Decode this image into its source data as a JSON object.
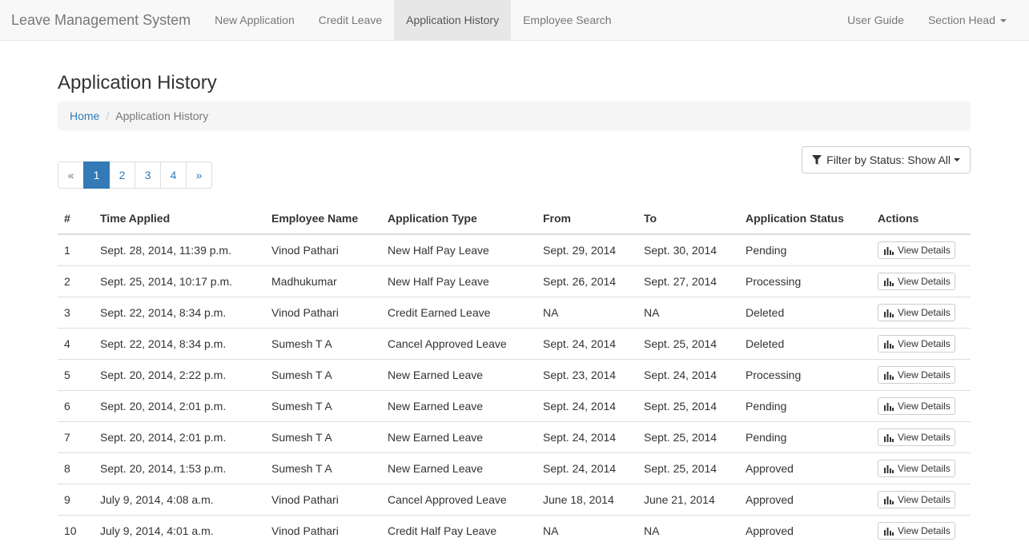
{
  "navbar": {
    "brand": "Leave Management System",
    "left_items": [
      {
        "label": "New Application",
        "active": false
      },
      {
        "label": "Credit Leave",
        "active": false
      },
      {
        "label": "Application History",
        "active": true
      },
      {
        "label": "Employee Search",
        "active": false
      }
    ],
    "user_guide": "User Guide",
    "user_menu": "Section Head"
  },
  "page": {
    "title": "Application History",
    "breadcrumb": {
      "home": "Home",
      "current": "Application History",
      "separator": "/"
    }
  },
  "pagination": {
    "prev": "«",
    "next": "»",
    "pages": [
      "1",
      "2",
      "3",
      "4"
    ],
    "current_page": "1"
  },
  "filter": {
    "icon": "filter-icon",
    "label": "Filter by Status: Show All"
  },
  "table": {
    "headers": [
      "#",
      "Time Applied",
      "Employee Name",
      "Application Type",
      "From",
      "To",
      "Application Status",
      "Actions"
    ],
    "action_label": "View Details",
    "action_icon": "bar-chart-icon",
    "rows": [
      {
        "num": "1",
        "time": "Sept. 28, 2014, 11:39 p.m.",
        "name": "Vinod Pathari",
        "type": "New Half Pay Leave",
        "from": "Sept. 29, 2014",
        "to": "Sept. 30, 2014",
        "status": "Pending"
      },
      {
        "num": "2",
        "time": "Sept. 25, 2014, 10:17 p.m.",
        "name": "Madhukumar",
        "type": "New Half Pay Leave",
        "from": "Sept. 26, 2014",
        "to": "Sept. 27, 2014",
        "status": "Processing"
      },
      {
        "num": "3",
        "time": "Sept. 22, 2014, 8:34 p.m.",
        "name": "Vinod Pathari",
        "type": "Credit Earned Leave",
        "from": "NA",
        "to": "NA",
        "status": "Deleted"
      },
      {
        "num": "4",
        "time": "Sept. 22, 2014, 8:34 p.m.",
        "name": "Sumesh T A",
        "type": "Cancel Approved Leave",
        "from": "Sept. 24, 2014",
        "to": "Sept. 25, 2014",
        "status": "Deleted"
      },
      {
        "num": "5",
        "time": "Sept. 20, 2014, 2:22 p.m.",
        "name": "Sumesh T A",
        "type": "New Earned Leave",
        "from": "Sept. 23, 2014",
        "to": "Sept. 24, 2014",
        "status": "Processing"
      },
      {
        "num": "6",
        "time": "Sept. 20, 2014, 2:01 p.m.",
        "name": "Sumesh T A",
        "type": "New Earned Leave",
        "from": "Sept. 24, 2014",
        "to": "Sept. 25, 2014",
        "status": "Pending"
      },
      {
        "num": "7",
        "time": "Sept. 20, 2014, 2:01 p.m.",
        "name": "Sumesh T A",
        "type": "New Earned Leave",
        "from": "Sept. 24, 2014",
        "to": "Sept. 25, 2014",
        "status": "Pending"
      },
      {
        "num": "8",
        "time": "Sept. 20, 2014, 1:53 p.m.",
        "name": "Sumesh T A",
        "type": "New Earned Leave",
        "from": "Sept. 24, 2014",
        "to": "Sept. 25, 2014",
        "status": "Approved"
      },
      {
        "num": "9",
        "time": "July 9, 2014, 4:08 a.m.",
        "name": "Vinod Pathari",
        "type": "Cancel Approved Leave",
        "from": "June 18, 2014",
        "to": "June 21, 2014",
        "status": "Approved"
      },
      {
        "num": "10",
        "time": "July 9, 2014, 4:01 a.m.",
        "name": "Vinod Pathari",
        "type": "Credit Half Pay Leave",
        "from": "NA",
        "to": "NA",
        "status": "Approved"
      }
    ]
  }
}
